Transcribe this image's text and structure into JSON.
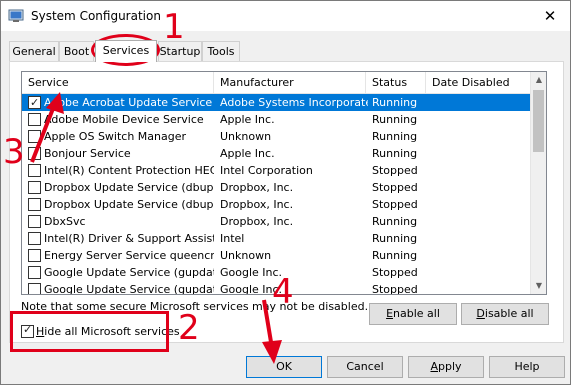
{
  "window": {
    "title": "System Configuration",
    "close_glyph": "✕"
  },
  "tabs": [
    {
      "label": "General"
    },
    {
      "label": "Boot"
    },
    {
      "label": "Services"
    },
    {
      "label": "Startup"
    },
    {
      "label": "Tools"
    }
  ],
  "list": {
    "headers": {
      "service": "Service",
      "manufacturer": "Manufacturer",
      "status": "Status",
      "date_disabled": "Date Disabled"
    },
    "rows": [
      {
        "service": "Adobe Acrobat Update Service",
        "manufacturer": "Adobe Systems Incorporated",
        "status": "Running",
        "checked": true,
        "selected": true
      },
      {
        "service": "Adobe Mobile Device Service",
        "manufacturer": "Apple Inc.",
        "status": "Running",
        "checked": false
      },
      {
        "service": "Apple OS Switch Manager",
        "manufacturer": "Unknown",
        "status": "Running",
        "checked": false
      },
      {
        "service": "Bonjour Service",
        "manufacturer": "Apple Inc.",
        "status": "Running",
        "checked": false
      },
      {
        "service": "Intel(R) Content Protection HEC...",
        "manufacturer": "Intel Corporation",
        "status": "Stopped",
        "checked": false
      },
      {
        "service": "Dropbox Update Service (dbupd...",
        "manufacturer": "Dropbox, Inc.",
        "status": "Stopped",
        "checked": false
      },
      {
        "service": "Dropbox Update Service (dbupd...",
        "manufacturer": "Dropbox, Inc.",
        "status": "Stopped",
        "checked": false
      },
      {
        "service": "DbxSvc",
        "manufacturer": "Dropbox, Inc.",
        "status": "Running",
        "checked": false
      },
      {
        "service": "Intel(R) Driver & Support Assistant",
        "manufacturer": "Intel",
        "status": "Running",
        "checked": false
      },
      {
        "service": "Energy Server Service queencreek",
        "manufacturer": "Unknown",
        "status": "Running",
        "checked": false
      },
      {
        "service": "Google Update Service (gupdate)",
        "manufacturer": "Google Inc.",
        "status": "Stopped",
        "checked": false
      },
      {
        "service": "Google Update Service (gupdatem)",
        "manufacturer": "Google Inc.",
        "status": "Stopped",
        "checked": false
      }
    ]
  },
  "note": "Note that some secure Microsoft services may not be disabled.",
  "buttons": {
    "enable_all_key": "E",
    "enable_all_rest": "nable all",
    "disable_all_key": "D",
    "disable_all_rest": "isable all",
    "ok": "OK",
    "cancel": "Cancel",
    "apply_key": "A",
    "apply_rest": "pply",
    "help": "Help"
  },
  "hide_ms": {
    "key": "H",
    "rest": "ide all Microsoft services",
    "checked": true
  },
  "annotations": {
    "n1": "1",
    "n2": "2",
    "n3": "3",
    "n4": "4"
  },
  "colors": {
    "accent": "#0078d7",
    "annotation": "#e0001a"
  }
}
